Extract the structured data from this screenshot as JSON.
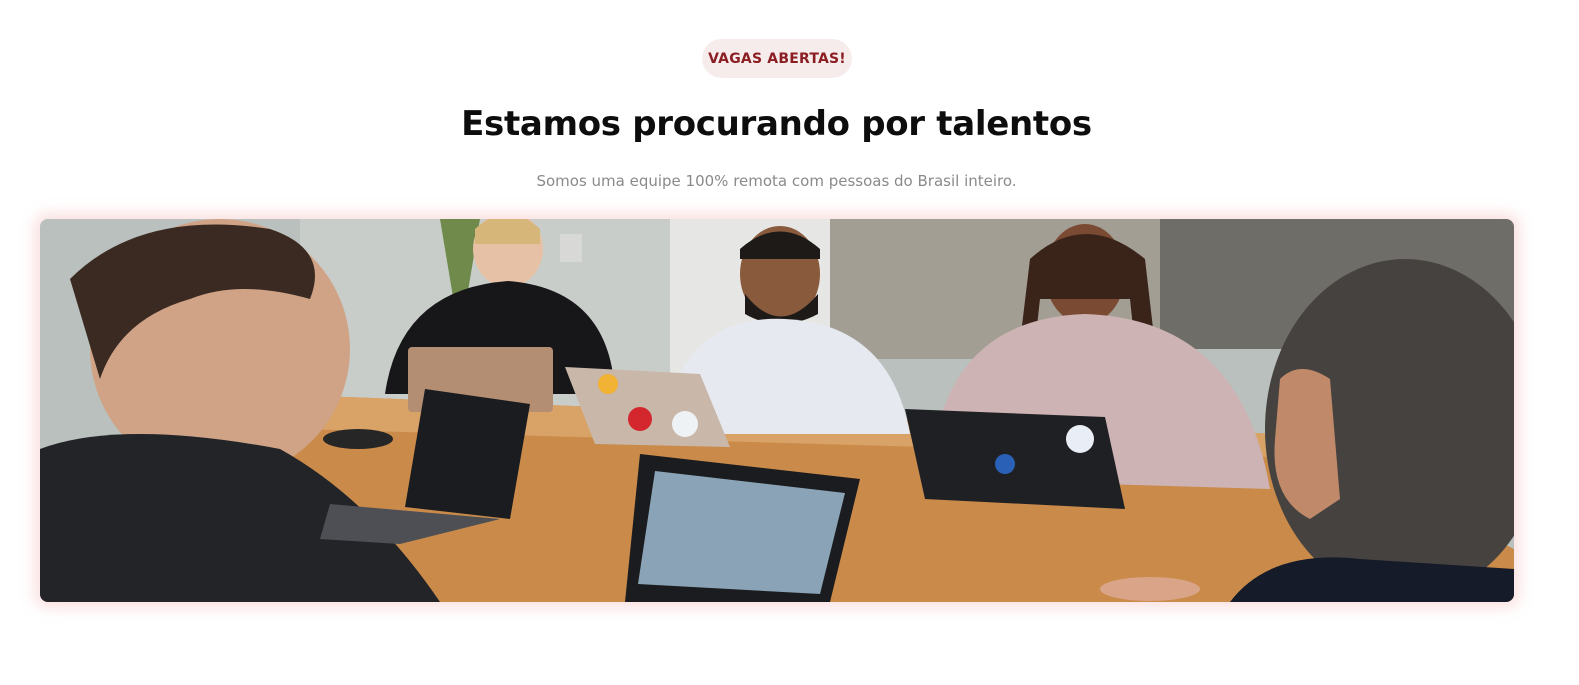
{
  "badge": {
    "label": "VAGAS ABERTAS!"
  },
  "heading": {
    "title": "Estamos procurando por talentos"
  },
  "description": {
    "text": "Somos uma equipe 100% remota com pessoas do Brasil inteiro."
  },
  "photo": {
    "subject": "team-meeting-photo"
  },
  "colors": {
    "badge_bg": "#f7ecec",
    "badge_text": "#8b1e22",
    "title": "#0d0d0d",
    "subtitle": "#8a8a8a",
    "photo_glow": "#f0aaaa"
  }
}
